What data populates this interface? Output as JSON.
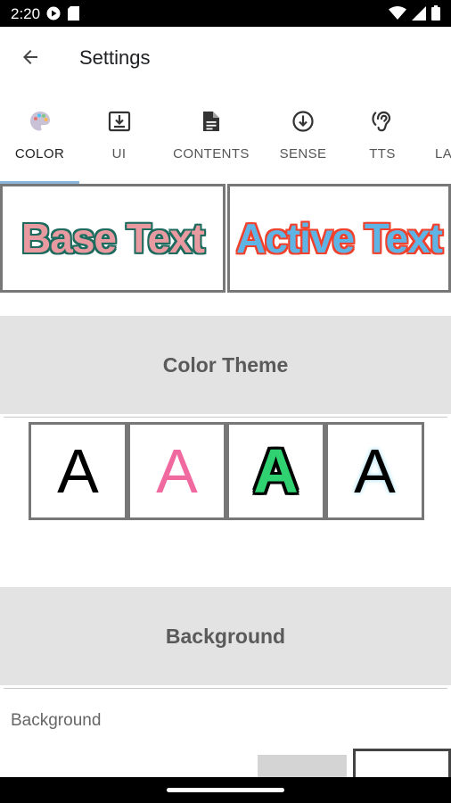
{
  "status_bar": {
    "time": "2:20",
    "left_icons": [
      "media-play-icon",
      "sd-card-icon"
    ],
    "right_icons": [
      "wifi-icon",
      "cell-signal-icon",
      "battery-icon"
    ]
  },
  "app_bar": {
    "back_icon": "arrow-back-icon",
    "title": "Settings"
  },
  "tabs": [
    {
      "label": "COLOR",
      "icon": "palette-icon",
      "active": true
    },
    {
      "label": "UI",
      "icon": "download-box-icon",
      "active": false
    },
    {
      "label": "CONTENTS",
      "icon": "document-icon",
      "active": false
    },
    {
      "label": "SENSE",
      "icon": "arrow-down-circle-icon",
      "active": false
    },
    {
      "label": "TTS",
      "icon": "hearing-icon",
      "active": false
    },
    {
      "label": "LA",
      "icon": "",
      "active": false
    }
  ],
  "preview": {
    "base_text": "Base Text",
    "active_text": "Active Text"
  },
  "sections": {
    "color_theme": "Color Theme",
    "background": "Background"
  },
  "themes": [
    {
      "glyph": "A"
    },
    {
      "glyph": "A"
    },
    {
      "glyph": "A"
    },
    {
      "glyph": "A"
    }
  ],
  "background": {
    "label": "Background"
  },
  "colors": {
    "tab_indicator": "#8ab4d8",
    "base_text_fill": "#e89aa0",
    "base_text_stroke": "#1d6b5e",
    "active_text_fill": "#5fb4e6",
    "active_text_stroke": "#f0412d",
    "section_header_bg": "#e3e3e3"
  }
}
